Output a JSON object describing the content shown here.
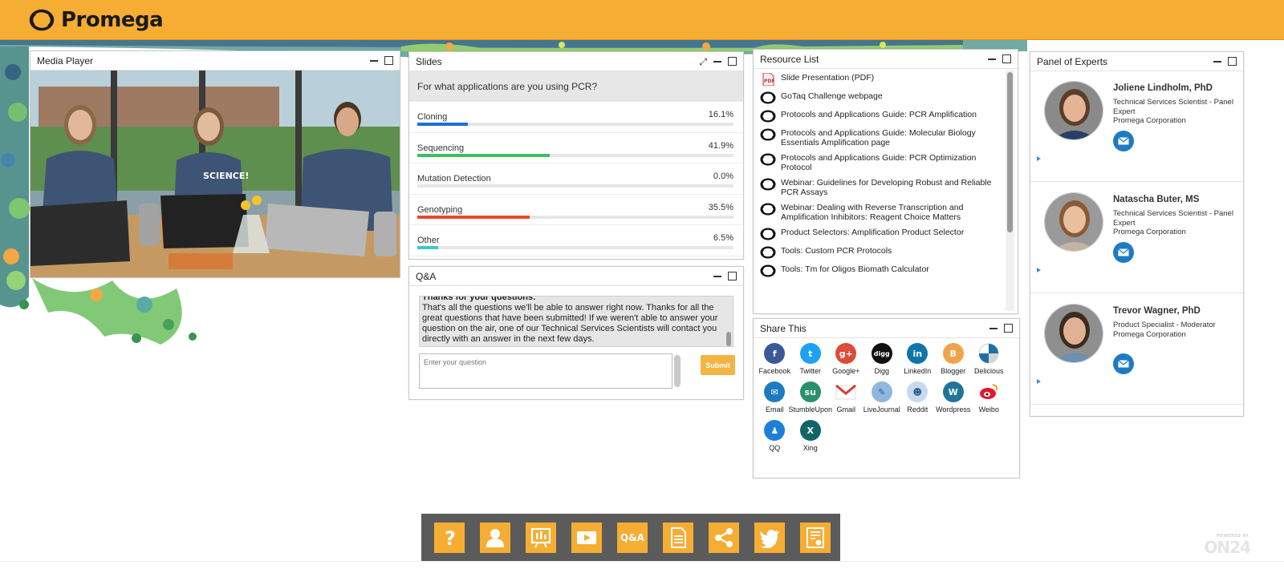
{
  "header": {
    "brand": "Promega",
    "accent": "#f6ad33"
  },
  "media_player": {
    "title": "Media Player"
  },
  "slides": {
    "title": "Slides",
    "question": "For what applications are you using PCR?",
    "options": [
      {
        "label": "Cloning",
        "pct": "16.1%",
        "value": 16.1,
        "color": "#1e6fd9"
      },
      {
        "label": "Sequencing",
        "pct": "41.9%",
        "value": 41.9,
        "color": "#3cbf63"
      },
      {
        "label": "Mutation Detection",
        "pct": "0.0%",
        "value": 0.0,
        "color": "#999999"
      },
      {
        "label": "Genotyping",
        "pct": "35.5%",
        "value": 35.5,
        "color": "#e8482a"
      },
      {
        "label": "Other",
        "pct": "6.5%",
        "value": 6.5,
        "color": "#3fc7c7"
      }
    ]
  },
  "qa": {
    "title": "Q&A",
    "message_heading": "Thanks for your questions:",
    "message_body": "That's all the questions we'll be able to answer right now. Thanks for all the great questions that have been submitted! If we weren't able to answer your question on the air, one of our Technical Services Scientists will contact you directly with an answer in the next few days.",
    "input_placeholder": "Enter your question",
    "submit_label": "Submit"
  },
  "resources": {
    "title": "Resource List",
    "items": [
      {
        "label": "Slide Presentation (PDF)",
        "icon": "pdf-icon"
      },
      {
        "label": "GoTaq Challenge webpage",
        "icon": "link-icon"
      },
      {
        "label": "Protocols and Applications Guide: PCR Amplification",
        "icon": "link-icon"
      },
      {
        "label": "Protocols and Applications Guide: Molecular Biology Essentials Amplification page",
        "icon": "link-icon"
      },
      {
        "label": "Protocols and Applications Guide: PCR Optimization Protocol",
        "icon": "link-icon"
      },
      {
        "label": "Webinar: Guidelines for Developing Robust and Reliable PCR Assays",
        "icon": "link-icon"
      },
      {
        "label": "Webinar: Dealing with Reverse Transcription and Amplification Inhibitors: Reagent Choice Matters",
        "icon": "link-icon"
      },
      {
        "label": "Product Selectors: Amplification Product Selector",
        "icon": "link-icon"
      },
      {
        "label": "Tools: Custom PCR Protocols",
        "icon": "link-icon"
      },
      {
        "label": "Tools: Tm for Oligos Biomath Calculator",
        "icon": "link-icon"
      }
    ]
  },
  "share": {
    "title": "Share This",
    "items": [
      {
        "label": "Facebook",
        "glyph": "f",
        "color": "#3b5998",
        "name": "facebook"
      },
      {
        "label": "Twitter",
        "glyph": "t",
        "color": "#1da1f2",
        "name": "twitter"
      },
      {
        "label": "Google+",
        "glyph": "g+",
        "color": "#dd4b39",
        "name": "google-plus"
      },
      {
        "label": "Digg",
        "glyph": "digg",
        "color": "#111111",
        "name": "digg"
      },
      {
        "label": "LinkedIn",
        "glyph": "in",
        "color": "#0e76a8",
        "name": "linkedin"
      },
      {
        "label": "Blogger",
        "glyph": "B",
        "color": "#f1a34c",
        "name": "blogger"
      },
      {
        "label": "Delicious",
        "glyph": "",
        "color": "#ffffff",
        "name": "delicious"
      },
      {
        "label": "Email",
        "glyph": "✉",
        "color": "#1f7bc1",
        "name": "email"
      },
      {
        "label": "StumbleUpon",
        "glyph": "su",
        "color": "#2a8f6c",
        "name": "stumbleupon"
      },
      {
        "label": "Gmail",
        "glyph": "M",
        "color": "#ffffff",
        "name": "gmail"
      },
      {
        "label": "LiveJournal",
        "glyph": "✎",
        "color": "#8fb8dd",
        "name": "livejournal"
      },
      {
        "label": "Reddit",
        "glyph": "☻",
        "color": "#c8d9ee",
        "name": "reddit"
      },
      {
        "label": "Wordpress",
        "glyph": "W",
        "color": "#21759b",
        "name": "wordpress"
      },
      {
        "label": "Weibo",
        "glyph": "◉",
        "color": "#ffffff",
        "name": "weibo"
      },
      {
        "label": "QQ",
        "glyph": "♟",
        "color": "#1e7fd6",
        "name": "qq"
      },
      {
        "label": "Xing",
        "glyph": "X",
        "color": "#126567",
        "name": "xing"
      }
    ]
  },
  "experts": {
    "title": "Panel of Experts",
    "people": [
      {
        "name": "Joliene Lindholm, PhD",
        "role": "Technical Services Scientist - Panel Expert",
        "org": "Promega Corporation"
      },
      {
        "name": "Natascha Buter, MS",
        "role": "Technical Services Scientist - Panel Expert",
        "org": "Promega Corporation"
      },
      {
        "name": "Trevor Wagner, PhD",
        "role": "Product Specialist - Moderator",
        "org": "Promega Corporation"
      }
    ]
  },
  "toolbar": {
    "qa_label": "Q&A",
    "tools": [
      "help-icon",
      "speakers-icon",
      "slides-icon",
      "media-player-icon",
      "qa-icon",
      "resources-icon",
      "share-icon",
      "twitter-icon",
      "certificate-icon"
    ]
  },
  "footer": {
    "powered": "POWERED BY",
    "vendor": "ON24"
  }
}
